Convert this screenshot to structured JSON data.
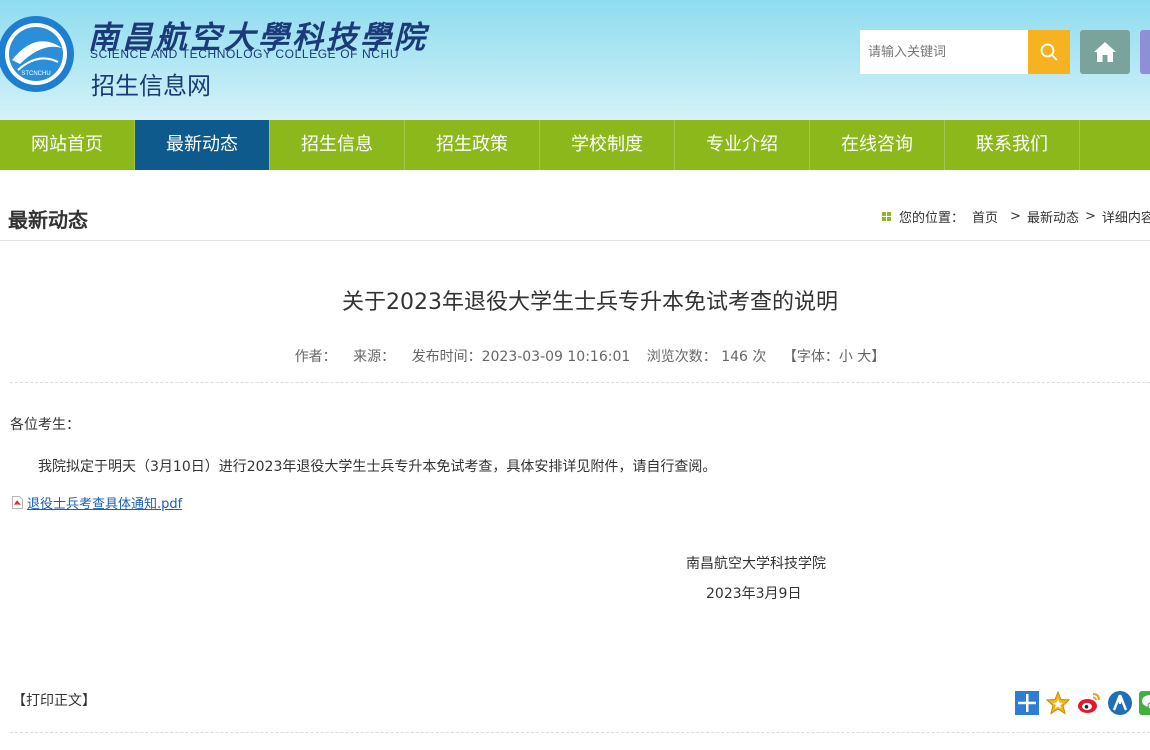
{
  "header": {
    "logo_emblem_text": "STCNCHU",
    "school_name_cn": "南昌航空大學科技學院",
    "school_name_en": "SCIENCE AND TECHNOLOGY COLLEGE OF NCHU",
    "site_name": "招生信息网",
    "search_placeholder": "请输入关键词",
    "colors": {
      "accent_search": "#f6b31f",
      "home_button": "#7aa39b"
    }
  },
  "nav": {
    "active_index": 1,
    "items": [
      {
        "label": "网站首页"
      },
      {
        "label": "最新动态"
      },
      {
        "label": "招生信息"
      },
      {
        "label": "招生政策"
      },
      {
        "label": "学校制度"
      },
      {
        "label": "专业介绍"
      },
      {
        "label": "在线咨询"
      },
      {
        "label": "联系我们"
      }
    ],
    "colors": {
      "bar": "#8cb81c",
      "active": "#0f5a8c"
    }
  },
  "section": {
    "title": "最新动态",
    "breadcrumb": {
      "prefix": "您的位置：",
      "home": "首页",
      "sep": ">",
      "category": "最新动态",
      "current": "详细内容"
    }
  },
  "article": {
    "title": "关于2023年退役大学生士兵专升本免试考查的说明",
    "meta": {
      "author_label": "作者：",
      "source_label": "来源：",
      "published": "发布时间：2023-03-09 10:16:01",
      "views_label": "浏览次数：",
      "views_count": "146",
      "views_unit": "次",
      "font_prefix": "【字体：",
      "font_small": "小",
      "font_large": "大",
      "font_suffix": "】"
    },
    "greeting": "各位考生：",
    "paragraph": "我院拟定于明天（3月10日）进行2023年退役大学生士兵专升本免试考查，具体安排详见附件，请自行查阅。",
    "attachment": "退役士兵考查具体通知.pdf",
    "signature": "南昌航空大学科技学院",
    "date": "2023年3月9日"
  },
  "footer": {
    "print_label": "【打印正文】",
    "share_icons": [
      "share-plus-icon",
      "favorite-star-icon",
      "weibo-icon",
      "renren-icon",
      "wechat-icon"
    ]
  }
}
